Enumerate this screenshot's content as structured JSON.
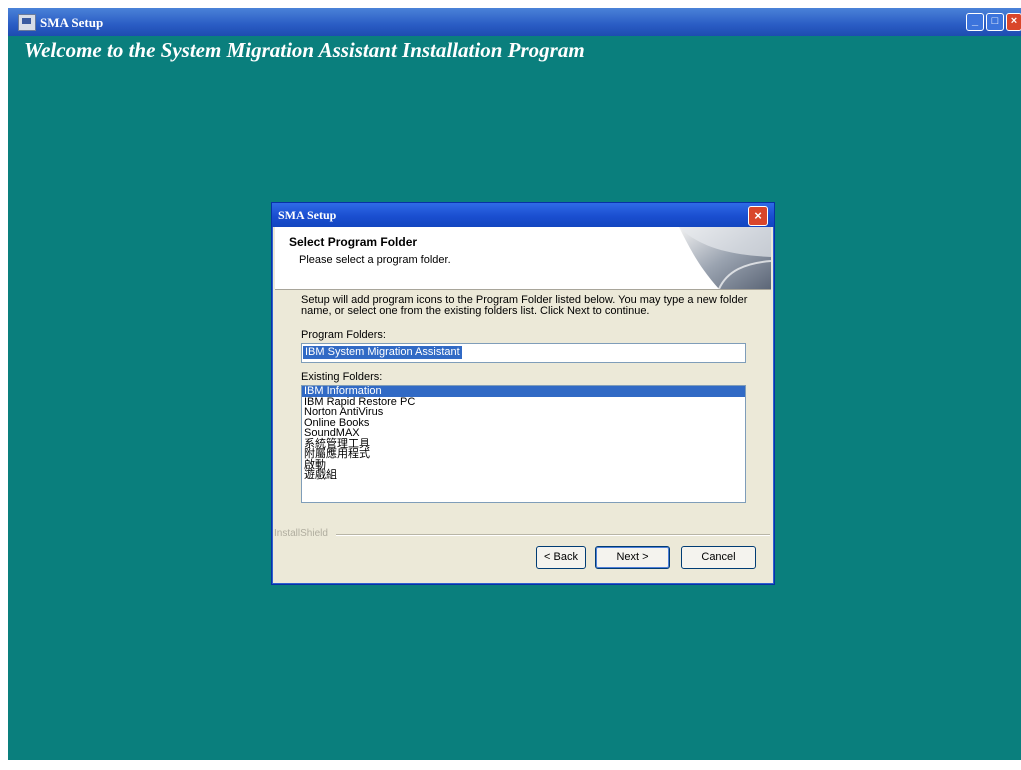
{
  "window": {
    "title": "SMA Setup",
    "heading": "Welcome to the System Migration Assistant Installation Program",
    "controls": {
      "minimize": "_",
      "maximize": "□",
      "close": "×"
    }
  },
  "dialog": {
    "title": "SMA Setup",
    "close": "×",
    "header_title": "Select Program Folder",
    "header_subtitle": "Please select a program folder.",
    "description": "Setup will add program icons to the Program Folder listed below.  You may type a new folder name, or select one from the existing folders list.  Click Next to continue.",
    "program_folders_label": "Program Folders:",
    "program_folder_value": "IBM System Migration Assistant",
    "existing_folders_label": "Existing Folders:",
    "existing_folders": [
      "IBM Information",
      "IBM Rapid Restore PC",
      "Norton AntiVirus",
      "Online Books",
      "SoundMAX",
      "系統管理工具",
      "附屬應用程式",
      "啟動",
      "遊戲組"
    ],
    "selected_index": 0,
    "brand": "InstallShield",
    "buttons": {
      "back": "< Back",
      "next": "Next >",
      "cancel": "Cancel"
    }
  },
  "colors": {
    "desktop": "#0a7f7d",
    "selection": "#316ac5",
    "titlebar": "#2a5cc4"
  },
  "icons": [
    "app-icon",
    "minimize-icon",
    "maximize-icon",
    "close-icon",
    "page-curl-graphic"
  ]
}
